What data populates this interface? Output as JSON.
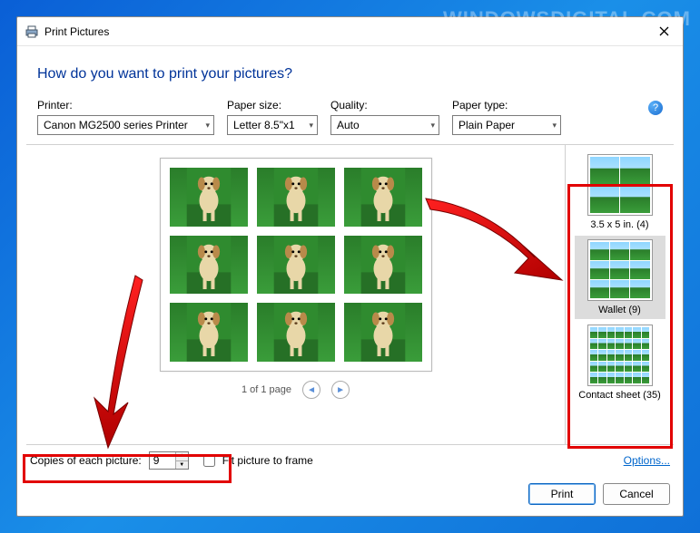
{
  "watermark": "WINDOWSDIGITAL.COM",
  "window": {
    "title": "Print Pictures"
  },
  "heading": "How do you want to print your pictures?",
  "fields": {
    "printer": {
      "label": "Printer:",
      "value": "Canon MG2500 series Printer"
    },
    "paper_size": {
      "label": "Paper size:",
      "value": "Letter 8.5\"x1"
    },
    "quality": {
      "label": "Quality:",
      "value": "Auto"
    },
    "paper_type": {
      "label": "Paper type:",
      "value": "Plain Paper"
    }
  },
  "pager": {
    "text": "1 of 1 page"
  },
  "layouts": [
    {
      "label": "3.5 x 5 in. (4)",
      "grid": [
        2,
        2
      ],
      "selected": false
    },
    {
      "label": "Wallet (9)",
      "grid": [
        3,
        3
      ],
      "selected": true
    },
    {
      "label": "Contact sheet (35)",
      "grid": [
        7,
        5
      ],
      "selected": false
    }
  ],
  "bottom": {
    "copies_label": "Copies of each picture:",
    "copies_value": "9",
    "fit_label": "Fit picture to frame",
    "options_text": "Options..."
  },
  "buttons": {
    "print": "Print",
    "cancel": "Cancel"
  }
}
